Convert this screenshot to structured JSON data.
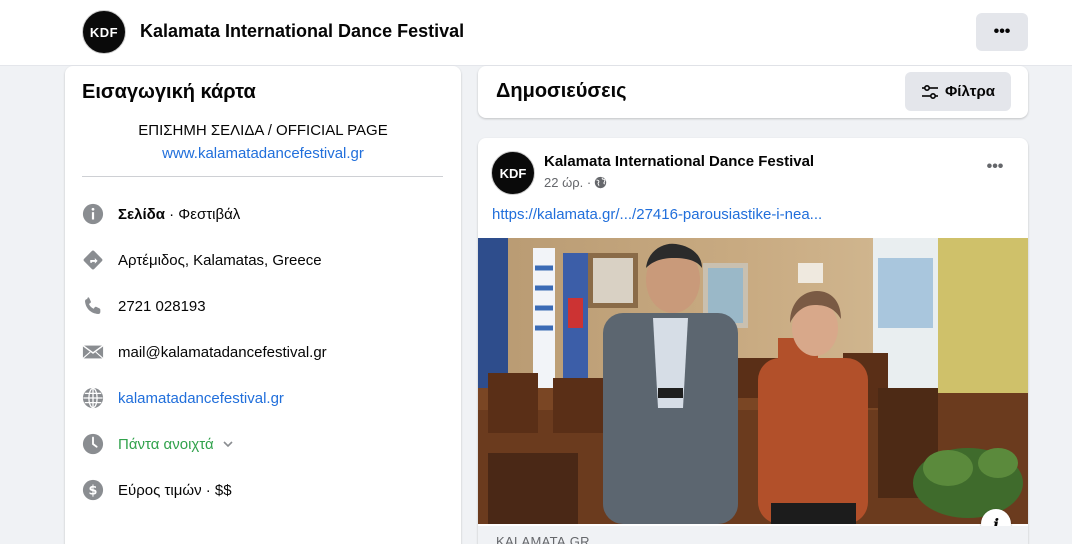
{
  "header": {
    "logo_text": "KDF",
    "title": "Kalamata International Dance Festival",
    "more_label": "•••"
  },
  "intro": {
    "heading": "Εισαγωγική κάρτα",
    "bio_line1": "ΕΠΙΣΗΜΗ ΣΕΛΙΔΑ / OFFICIAL PAGE",
    "bio_line2": "www.kalamatadancefestival.gr",
    "items": [
      {
        "icon": "info-icon",
        "bold": "Σελίδα",
        "text": " · Φεστιβάλ"
      },
      {
        "icon": "directions-icon",
        "text": "Αρτέμιδος, Kalamatas, Greece"
      },
      {
        "icon": "phone-icon",
        "text": "2721 028193"
      },
      {
        "icon": "mail-icon",
        "text": "mail@kalamatadancefestival.gr"
      },
      {
        "icon": "globe-icon",
        "text": "kalamatadancefestival.gr"
      },
      {
        "icon": "clock-icon",
        "text": "Πάντα ανοιχτά"
      },
      {
        "icon": "dollar-icon",
        "text": "Εύρος τιμών · $$"
      }
    ]
  },
  "posts_header": {
    "heading": "Δημοσιεύσεις",
    "filter_label": "Φίλτρα"
  },
  "post": {
    "avatar_text": "KDF",
    "author": "Kalamata International Dance Festival",
    "time": "22 ώρ. ·",
    "more_label": "•••",
    "link": "https://kalamata.gr/.../27416-parousiastike-i-nea...",
    "info_badge": "i",
    "source": "KALAMATA.GR"
  },
  "colors": {
    "accent_link": "#216fdb",
    "open_green": "#31a24c",
    "page_bg": "#f0f2f5"
  }
}
